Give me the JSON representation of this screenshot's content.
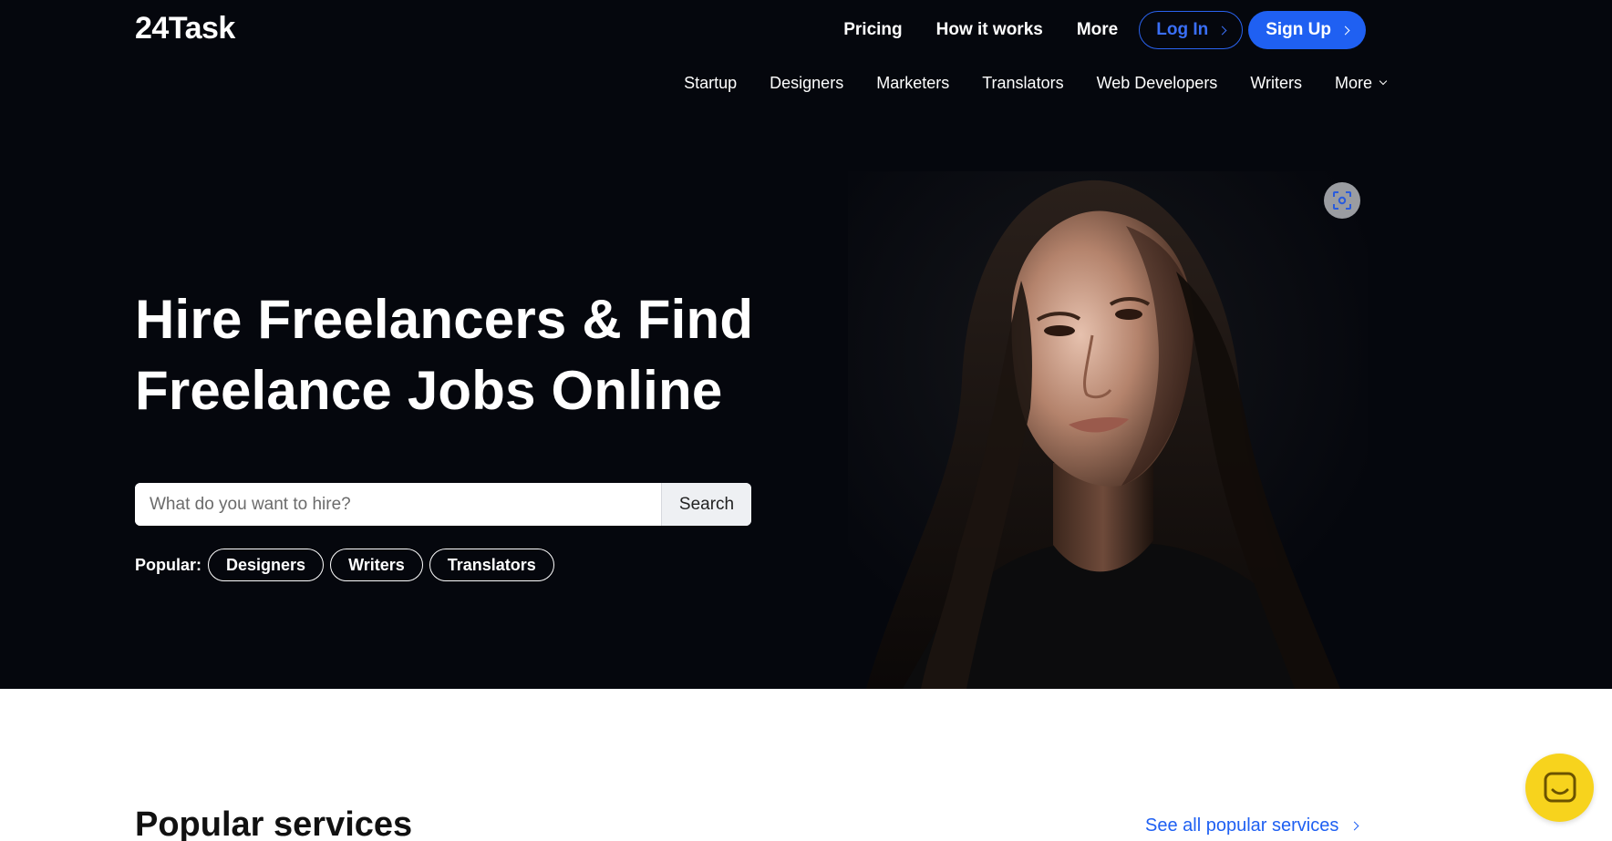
{
  "header": {
    "logo": "24Task",
    "nav": [
      "Pricing",
      "How it works",
      "More"
    ],
    "login_label": "Log In",
    "signup_label": "Sign Up"
  },
  "subnav": {
    "items": [
      "Startup",
      "Designers",
      "Marketers",
      "Translators",
      "Web Developers",
      "Writers"
    ],
    "more_label": "More"
  },
  "hero": {
    "headline_line1": "Hire Freelancers & Find",
    "headline_line2": "Freelance Jobs Online",
    "search_placeholder": "What do you want to hire?",
    "search_button": "Search",
    "popular_label": "Popular:",
    "popular_tags": [
      "Designers",
      "Writers",
      "Translators"
    ]
  },
  "section": {
    "title": "Popular services",
    "see_all": "See all popular services"
  },
  "colors": {
    "hero_bg": "#05070d",
    "accent": "#1f60f2",
    "chat_bg": "#f7d31d"
  },
  "icons": {
    "scan": "scan-icon",
    "chat": "chat-icon"
  }
}
